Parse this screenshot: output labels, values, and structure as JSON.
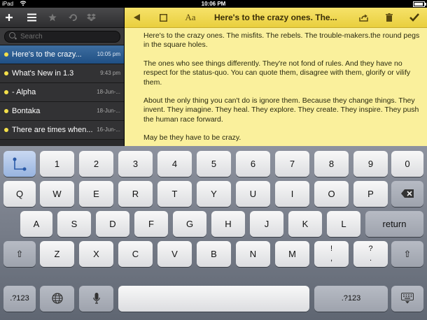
{
  "status_bar": {
    "carrier": "iPad",
    "wifi": "wifi-icon",
    "time": "10:06 PM",
    "battery": "battery-icon"
  },
  "sidebar": {
    "toolbar": {
      "add": "+",
      "list": "☰",
      "star": "★",
      "undo": "↶",
      "dropbox": "⬡"
    },
    "search_placeholder": "Search",
    "notes": [
      {
        "title": "Here's to the crazy...",
        "date": "10:05 pm",
        "selected": true
      },
      {
        "title": "What's New in 1.3",
        "date": "9:43 pm",
        "selected": false
      },
      {
        "title": "- Alpha",
        "date": "18-Jun-...",
        "selected": false
      },
      {
        "title": "Bontaka",
        "date": "18-Jun-...",
        "selected": false
      },
      {
        "title": "There are times when...",
        "date": "16-Jun-...",
        "selected": false
      }
    ]
  },
  "editor": {
    "back": "◀",
    "format": "Aa",
    "title": "Here's to the crazy ones. The...",
    "paragraphs": [
      "Here's to the crazy ones. The misfits. The rebels. The trouble-makers.the round pegs in the square holes.",
      "The ones who see things differently. They're not fond of rules. And they have no respect for the status-quo. You can quote them, disagree with them, glorify or vilify them.",
      "About the only thing you can't do is ignore them. Because they change things. They invent. They imagine. They heal. They explore. They create. They inspire. They push the human race forward.",
      "May be they have to be crazy."
    ]
  },
  "keyboard": {
    "number_row": [
      "1",
      "2",
      "3",
      "4",
      "5",
      "6",
      "7",
      "8",
      "9",
      "0"
    ],
    "row1": [
      "Q",
      "W",
      "E",
      "R",
      "T",
      "Y",
      "U",
      "I",
      "O",
      "P"
    ],
    "row2": [
      "A",
      "S",
      "D",
      "F",
      "G",
      "H",
      "J",
      "K",
      "L"
    ],
    "row3": [
      "Z",
      "X",
      "C",
      "V",
      "B",
      "N",
      "M"
    ],
    "punct1_top": "!",
    "punct1_bottom": ",",
    "punct2_top": "?",
    "punct2_bottom": ".",
    "return": "return",
    "shift": "⇧",
    "delete": "⌫",
    "mode": ".?123",
    "globe": "globe-icon",
    "mic": "microphone-icon",
    "hide": "hide-keyboard-icon"
  }
}
